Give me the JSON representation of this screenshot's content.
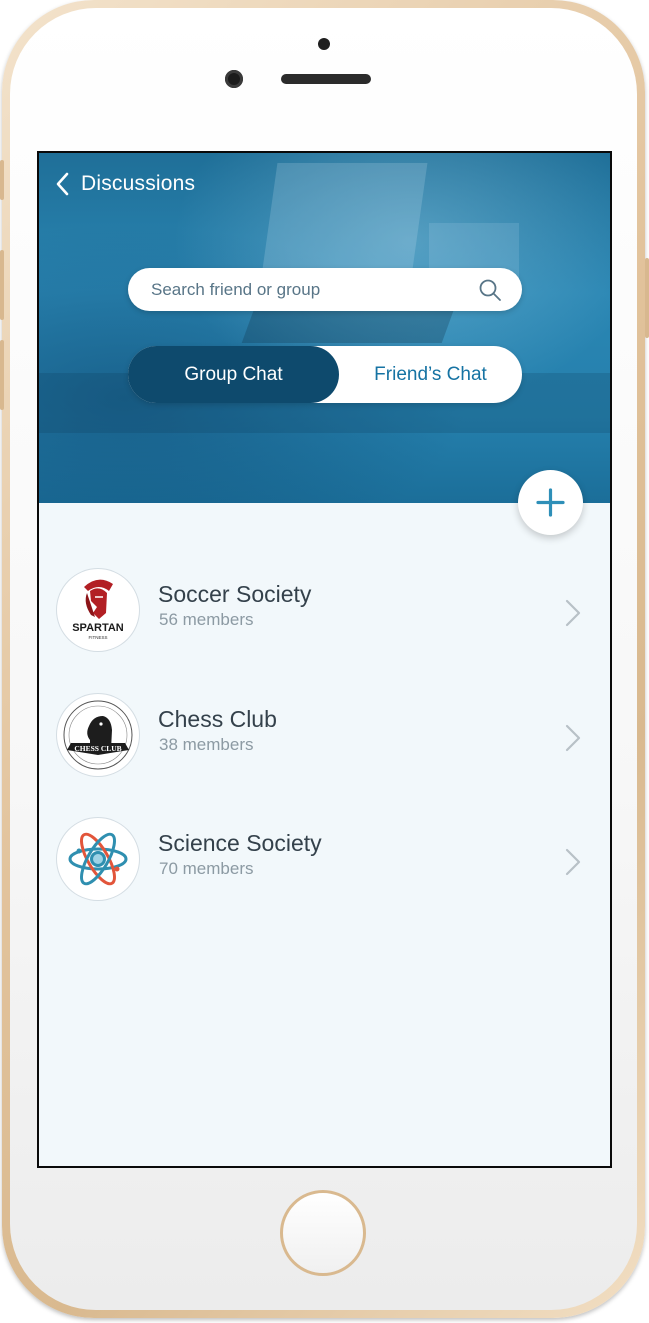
{
  "header": {
    "title": "Discussions"
  },
  "search": {
    "placeholder": "Search friend or group"
  },
  "tabs": [
    {
      "label": "Group Chat",
      "active": true
    },
    {
      "label": "Friend’s Chat",
      "active": false
    }
  ],
  "groups": [
    {
      "name": "Soccer Society",
      "members": "56 members",
      "avatar_icon": "spartan-fitness-logo",
      "avatar_text": "SPARTAN",
      "avatar_subtext": "FITNESS"
    },
    {
      "name": "Chess Club",
      "members": "38 members",
      "avatar_icon": "chess-knight-logo",
      "avatar_text": "CHESS CLUB"
    },
    {
      "name": "Science Society",
      "members": "70 members",
      "avatar_icon": "atom-logo"
    }
  ],
  "colors": {
    "header_blue": "#2580ad",
    "tab_active": "#0e4a6d",
    "tab_inactive_text": "#1673a3",
    "accent": "#2e8fb8",
    "list_background": "#f2f8fb"
  }
}
